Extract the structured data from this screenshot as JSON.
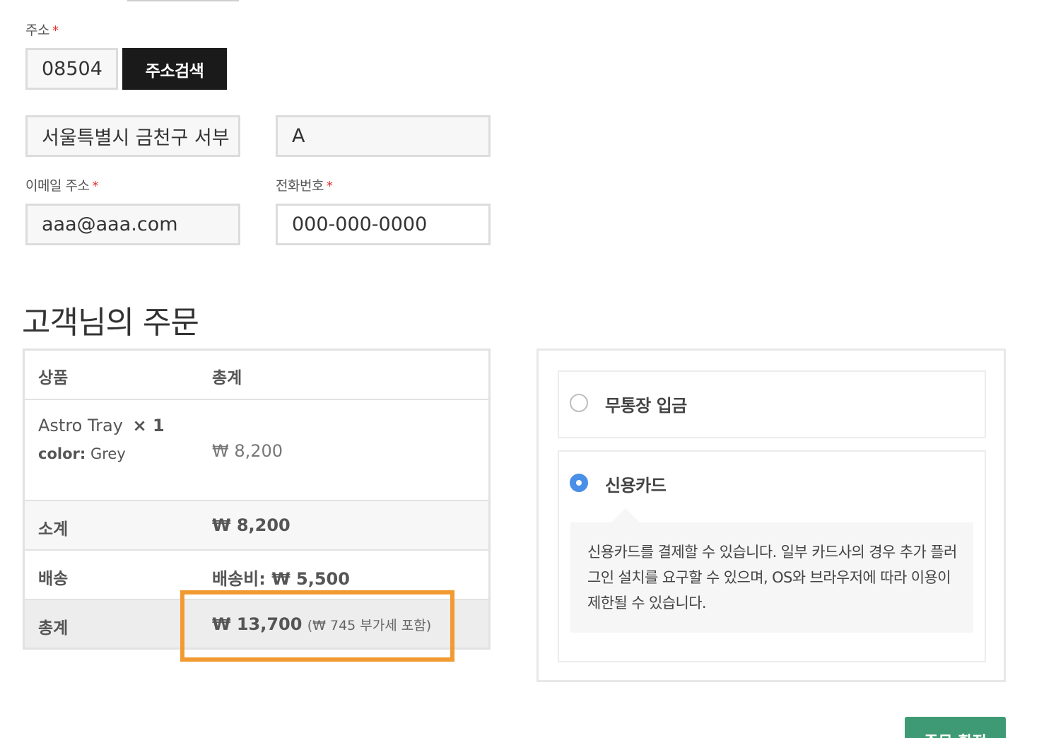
{
  "address": {
    "label": "주소",
    "required_mark": "*",
    "postcode_value": "08504",
    "search_button": "주소검색",
    "address1_value": "서울특별시 금천구 서부",
    "address2_value": "A"
  },
  "email": {
    "label": "이메일 주소",
    "required_mark": "*",
    "value": "aaa@aaa.com"
  },
  "phone": {
    "label": "전화번호",
    "required_mark": "*",
    "value": "000-000-0000"
  },
  "order": {
    "heading": "고객님의 주문",
    "columns": [
      "상품",
      "총계"
    ],
    "item": {
      "name": "Astro Tray",
      "qty": "× 1",
      "variant_key": "color:",
      "variant_value": "Grey",
      "total": "₩ 8,200"
    },
    "subtotal": {
      "label": "소계",
      "value": "₩ 8,200"
    },
    "shipping": {
      "label": "배송",
      "value": "배송비: ₩ 5,500"
    },
    "total": {
      "label": "총계",
      "value": "₩ 13,700",
      "tax_note": "(₩ 745 부가세 포함)"
    }
  },
  "payment": {
    "options": [
      {
        "label": "무통장 입금",
        "selected": false
      },
      {
        "label": "신용카드",
        "selected": true
      }
    ],
    "card_description": "신용카드를 결제할 수 있습니다. 일부 카드사의 경우 추가 플러그인 설치를 요구할 수 있으며, OS와 브라우저에 따라 이용이 제한될 수 있습니다."
  },
  "confirm_button": "주문 확정",
  "colors": {
    "highlight": "#f29a32",
    "radio_selected": "#4a8fe8",
    "confirm": "#3d9a74",
    "dark_button": "#1a1a1a"
  }
}
